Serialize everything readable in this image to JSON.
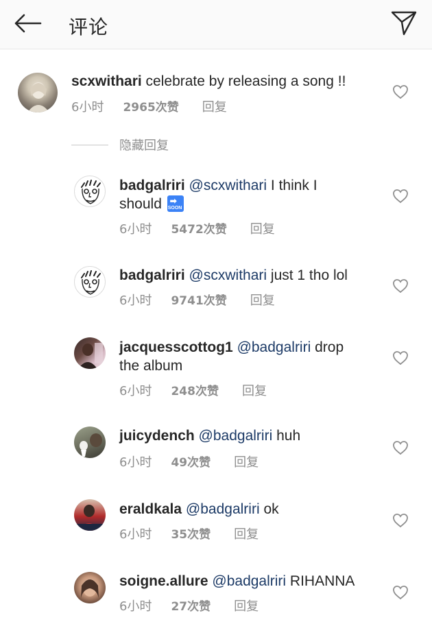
{
  "header": {
    "title": "评论",
    "back_icon": "arrow-left-icon",
    "send_icon": "paper-plane-icon"
  },
  "top_comment": {
    "username": "scxwithari",
    "text": " celebrate by releasing a song !!",
    "time": "6小时",
    "likes": "2965次赞",
    "reply": "回复"
  },
  "hide_replies_label": "隐藏回复",
  "replies": [
    {
      "username": "badgalriri",
      "mention": "@scxwithari",
      "line1": " I think I",
      "line2": "should",
      "emoji": "soon-arrow-emoji",
      "time": "6小时",
      "likes": "5472次赞",
      "reply": "回复"
    },
    {
      "username": "badgalriri",
      "mention": "@scxwithari",
      "text": " just 1 tho lol",
      "time": "6小时",
      "likes": "9741次赞",
      "reply": "回复"
    },
    {
      "username": "jacquesscottog1",
      "mention": "@badgalriri",
      "text": " drop",
      "line2": "the album",
      "time": "6小时",
      "likes": "248次赞",
      "reply": "回复"
    },
    {
      "username": "juicydench",
      "mention": "@badgalriri",
      "text": " huh",
      "time": "6小时",
      "likes": "49次赞",
      "reply": "回复"
    },
    {
      "username": "eraldkala",
      "mention": "@badgalriri",
      "text": " ok",
      "time": "6小时",
      "likes": "35次赞",
      "reply": "回复"
    },
    {
      "username": "soigne.allure",
      "mention": "@badgalriri",
      "text": " RIHANNA",
      "time": "6小时",
      "likes": "27次赞",
      "reply": "回复"
    }
  ],
  "colors": {
    "mention": "#1c3a66",
    "meta": "#8e8e8e",
    "text": "#262626"
  }
}
